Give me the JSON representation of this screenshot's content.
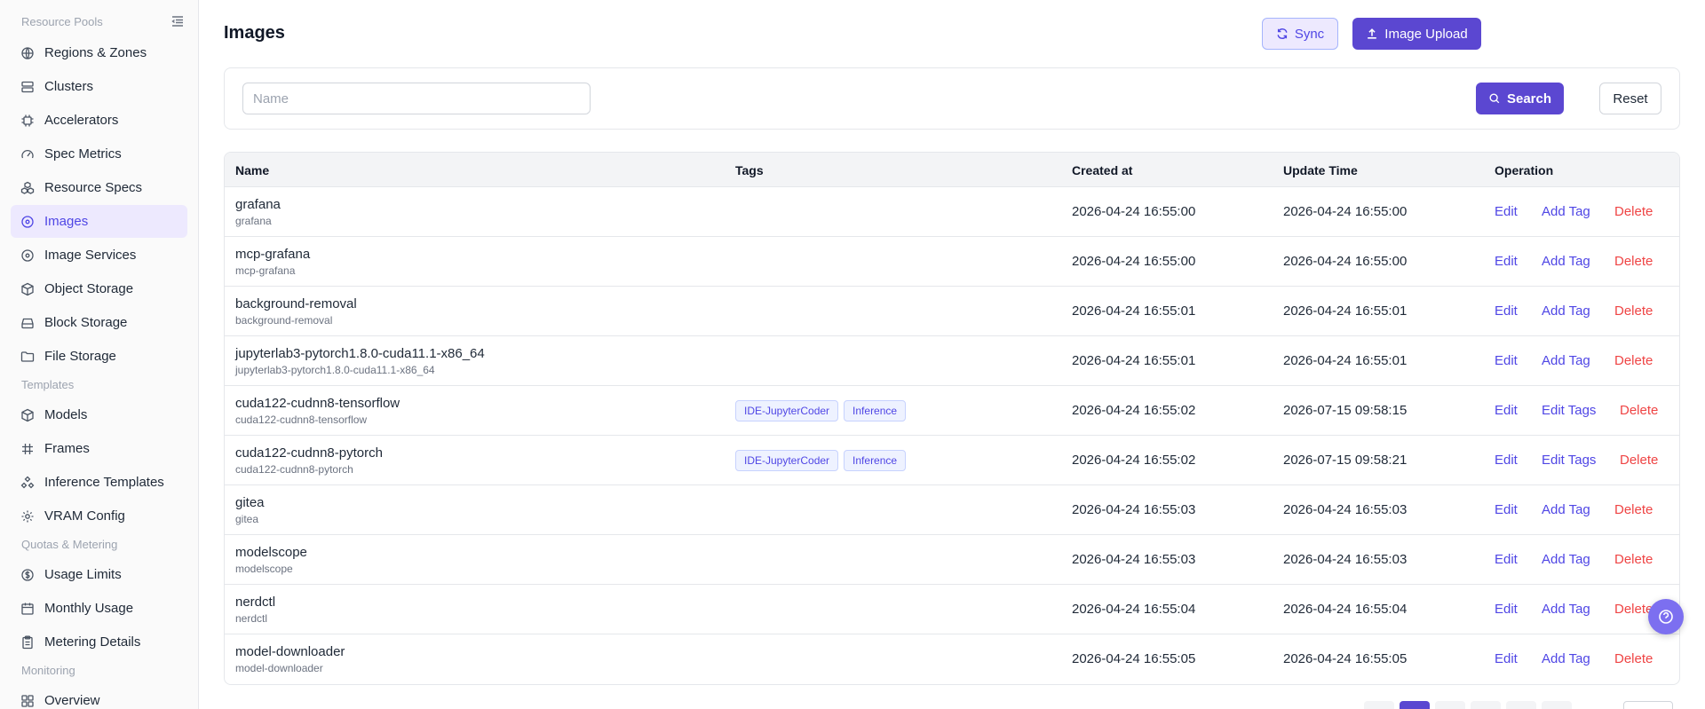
{
  "sidebar": {
    "groups": {
      "resource_pools": "Resource Pools",
      "templates": "Templates",
      "quotas": "Quotas & Metering",
      "monitoring": "Monitoring"
    },
    "items": [
      {
        "label": "Regions & Zones",
        "icon": "globe-icon"
      },
      {
        "label": "Clusters",
        "icon": "server-icon"
      },
      {
        "label": "Accelerators",
        "icon": "chip-icon"
      },
      {
        "label": "Spec Metrics",
        "icon": "gauge-icon"
      },
      {
        "label": "Resource Specs",
        "icon": "cubes-icon"
      },
      {
        "label": "Images",
        "icon": "disc-icon",
        "active": true
      },
      {
        "label": "Image Services",
        "icon": "disc-icon"
      },
      {
        "label": "Object Storage",
        "icon": "box-icon"
      },
      {
        "label": "Block Storage",
        "icon": "hard-drive-icon"
      },
      {
        "label": "File Storage",
        "icon": "folder-icon"
      },
      {
        "label": "Models",
        "icon": "box-icon"
      },
      {
        "label": "Frames",
        "icon": "hash-icon"
      },
      {
        "label": "Inference Templates",
        "icon": "workflow-icon"
      },
      {
        "label": "VRAM Config",
        "icon": "gear-icon"
      },
      {
        "label": "Usage Limits",
        "icon": "coin-icon"
      },
      {
        "label": "Monthly Usage",
        "icon": "calendar-icon"
      },
      {
        "label": "Metering Details",
        "icon": "clipboard-icon"
      },
      {
        "label": "Overview",
        "icon": "grid-icon"
      }
    ]
  },
  "header": {
    "title": "Images",
    "sync_label": "Sync",
    "upload_label": "Image Upload"
  },
  "filter": {
    "name_placeholder": "Name",
    "name_value": "",
    "search_label": "Search",
    "reset_label": "Reset"
  },
  "table": {
    "columns": {
      "name": "Name",
      "tags": "Tags",
      "created": "Created at",
      "updated": "Update Time",
      "operation": "Operation"
    },
    "rows": [
      {
        "name": "grafana",
        "sub": "grafana",
        "tags": [],
        "created": "2026-04-24 16:55:00",
        "updated": "2026-04-24 16:55:00",
        "ops": [
          "Edit",
          "Add Tag",
          "Delete"
        ]
      },
      {
        "name": "mcp-grafana",
        "sub": "mcp-grafana",
        "tags": [],
        "created": "2026-04-24 16:55:00",
        "updated": "2026-04-24 16:55:00",
        "ops": [
          "Edit",
          "Add Tag",
          "Delete"
        ]
      },
      {
        "name": "background-removal",
        "sub": "background-removal",
        "tags": [],
        "created": "2026-04-24 16:55:01",
        "updated": "2026-04-24 16:55:01",
        "ops": [
          "Edit",
          "Add Tag",
          "Delete"
        ]
      },
      {
        "name": "jupyterlab3-pytorch1.8.0-cuda11.1-x86_64",
        "sub": "jupyterlab3-pytorch1.8.0-cuda11.1-x86_64",
        "tags": [],
        "created": "2026-04-24 16:55:01",
        "updated": "2026-04-24 16:55:01",
        "ops": [
          "Edit",
          "Add Tag",
          "Delete"
        ]
      },
      {
        "name": "cuda122-cudnn8-tensorflow",
        "sub": "cuda122-cudnn8-tensorflow",
        "tags": [
          "IDE-JupyterCoder",
          "Inference"
        ],
        "created": "2026-04-24 16:55:02",
        "updated": "2026-07-15 09:58:15",
        "ops": [
          "Edit",
          "Edit Tags",
          "Delete"
        ]
      },
      {
        "name": "cuda122-cudnn8-pytorch",
        "sub": "cuda122-cudnn8-pytorch",
        "tags": [
          "IDE-JupyterCoder",
          "Inference"
        ],
        "created": "2026-04-24 16:55:02",
        "updated": "2026-07-15 09:58:21",
        "ops": [
          "Edit",
          "Edit Tags",
          "Delete"
        ]
      },
      {
        "name": "gitea",
        "sub": "gitea",
        "tags": [],
        "created": "2026-04-24 16:55:03",
        "updated": "2026-04-24 16:55:03",
        "ops": [
          "Edit",
          "Add Tag",
          "Delete"
        ]
      },
      {
        "name": "modelscope",
        "sub": "modelscope",
        "tags": [],
        "created": "2026-04-24 16:55:03",
        "updated": "2026-04-24 16:55:03",
        "ops": [
          "Edit",
          "Add Tag",
          "Delete"
        ]
      },
      {
        "name": "nerdctl",
        "sub": "nerdctl",
        "tags": [],
        "created": "2026-04-24 16:55:04",
        "updated": "2026-04-24 16:55:04",
        "ops": [
          "Edit",
          "Add Tag",
          "Delete"
        ]
      },
      {
        "name": "model-downloader",
        "sub": "model-downloader",
        "tags": [],
        "created": "2026-04-24 16:55:05",
        "updated": "2026-04-24 16:55:05",
        "ops": [
          "Edit",
          "Add Tag",
          "Delete"
        ]
      }
    ]
  },
  "colors": {
    "accent": "#5b47d1",
    "danger": "#ef4444",
    "active_bg": "#ede9fe"
  }
}
